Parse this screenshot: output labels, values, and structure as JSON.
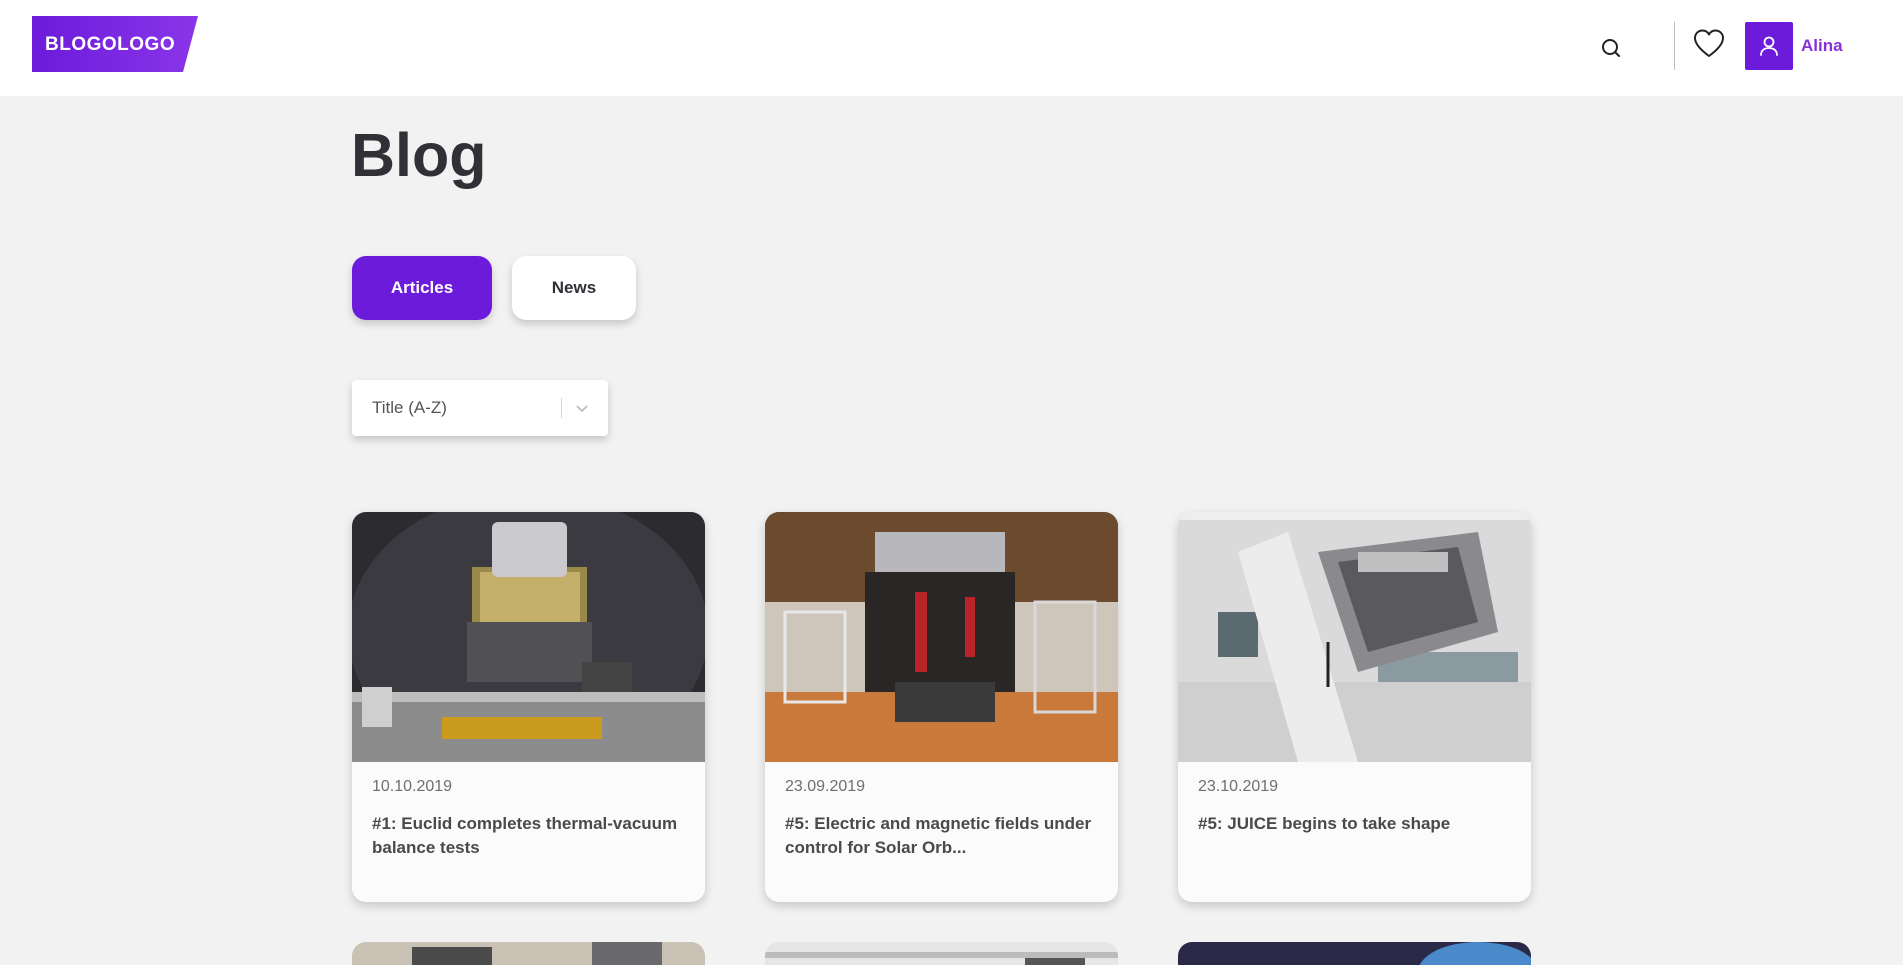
{
  "header": {
    "logo_text": "BLOGOLOGO",
    "search_icon": "search-icon",
    "favorites_icon": "heart-icon",
    "user_icon": "user-icon",
    "user_name": "Alina"
  },
  "page": {
    "title": "Blog"
  },
  "tabs": [
    {
      "label": "Articles",
      "active": true
    },
    {
      "label": "News",
      "active": false
    }
  ],
  "sort": {
    "selected": "Title (A-Z)",
    "icon": "chevron-down-icon"
  },
  "cards": [
    {
      "date": "10.10.2019",
      "title": "#1: Euclid completes thermal-vacuum balance tests"
    },
    {
      "date": "23.09.2019",
      "title": "#5: Electric and magnetic fields under control for Solar Orb..."
    },
    {
      "date": "23.10.2019",
      "title": "#5: JUICE begins to take shape"
    }
  ],
  "colors": {
    "accent": "#6c1bdb",
    "user_name": "#8b30d9",
    "background": "#f2f2f2",
    "text": "#313037"
  }
}
